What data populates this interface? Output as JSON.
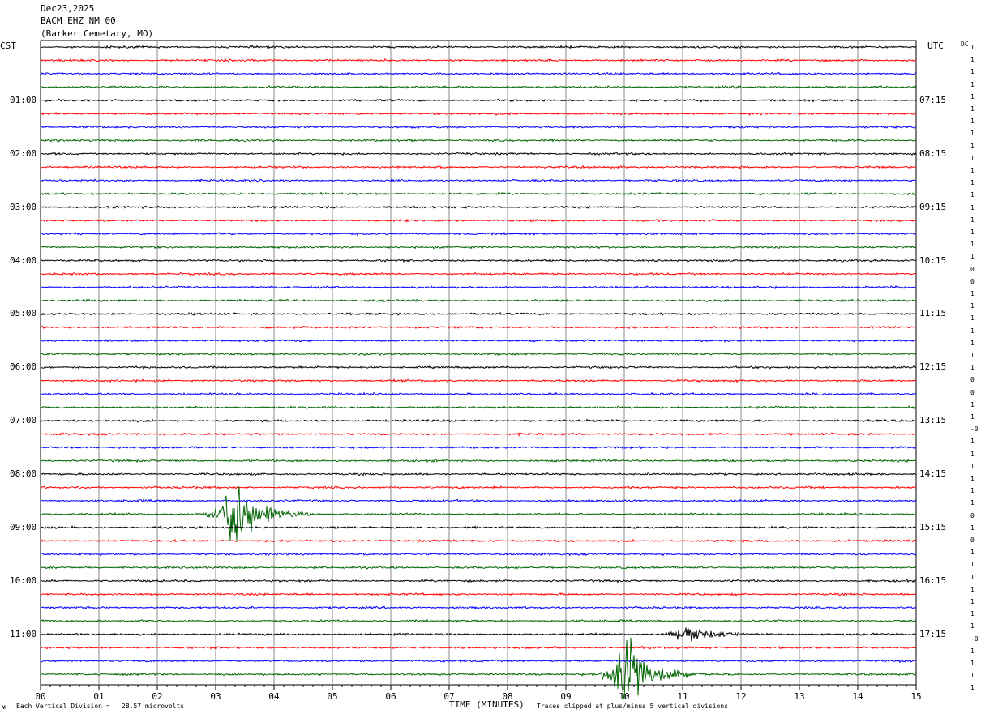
{
  "header": {
    "date": "Dec23,2025",
    "station": "BACM EHZ NM 00",
    "location": "(Barker Cemetary, MO)"
  },
  "left_label": "CST",
  "right_label": "UTC",
  "dc_label": "DC",
  "footer": {
    "scale_text": "Each Vertical Division =   28.57 microvolts",
    "xlabel": "TIME (MINUTES)",
    "clip_text": "Traces clipped at plus/minus 5 vertical divisions"
  },
  "colors": {
    "black": "#000000",
    "red": "#ff0000",
    "blue": "#0000ff",
    "green": "#006400",
    "grid": "#888888"
  },
  "chart_data": {
    "type": "line",
    "title": "BACM EHZ NM 00 (Barker Cemetary, MO) Dec23,2025",
    "xlabel": "TIME (MINUTES)",
    "xlim": [
      0,
      15
    ],
    "x_ticks": [
      "00",
      "01",
      "02",
      "03",
      "04",
      "05",
      "06",
      "07",
      "08",
      "09",
      "10",
      "11",
      "12",
      "13",
      "14",
      "15"
    ],
    "left_time_labels": [
      "01:00",
      "02:00",
      "03:00",
      "04:00",
      "05:00",
      "06:00",
      "07:00",
      "08:00",
      "09:00",
      "10:00",
      "11:00"
    ],
    "right_time_labels": [
      "07:15",
      "08:15",
      "09:15",
      "10:15",
      "11:15",
      "12:15",
      "13:15",
      "14:15",
      "15:15",
      "16:15",
      "17:15"
    ],
    "trace_count": 48,
    "trace_color_cycle": [
      "black",
      "red",
      "blue",
      "green"
    ],
    "dc_offsets": [
      "1",
      "1",
      "1",
      "1",
      "1",
      "1",
      "1",
      "1",
      "1",
      "1",
      "1",
      "1",
      "1",
      "1",
      "1",
      "1",
      "1",
      "1",
      "0",
      "0",
      "1",
      "1",
      "1",
      "1",
      "1",
      "1",
      "1",
      "0",
      "0",
      "1",
      "1",
      "-0",
      "1",
      "1",
      "1",
      "1",
      "1",
      "1",
      "0",
      "1",
      "0",
      "1",
      "1",
      "1",
      "1",
      "1",
      "1",
      "1",
      "-0",
      "1",
      "1",
      "1",
      "1"
    ],
    "events": [
      {
        "trace": 35,
        "minute": 3.2,
        "amplitude": "clipped"
      },
      {
        "trace": 44,
        "minute": 11.0,
        "amplitude": "large"
      },
      {
        "trace": 47,
        "minute": 9.9,
        "amplitude": "clipped"
      }
    ]
  }
}
